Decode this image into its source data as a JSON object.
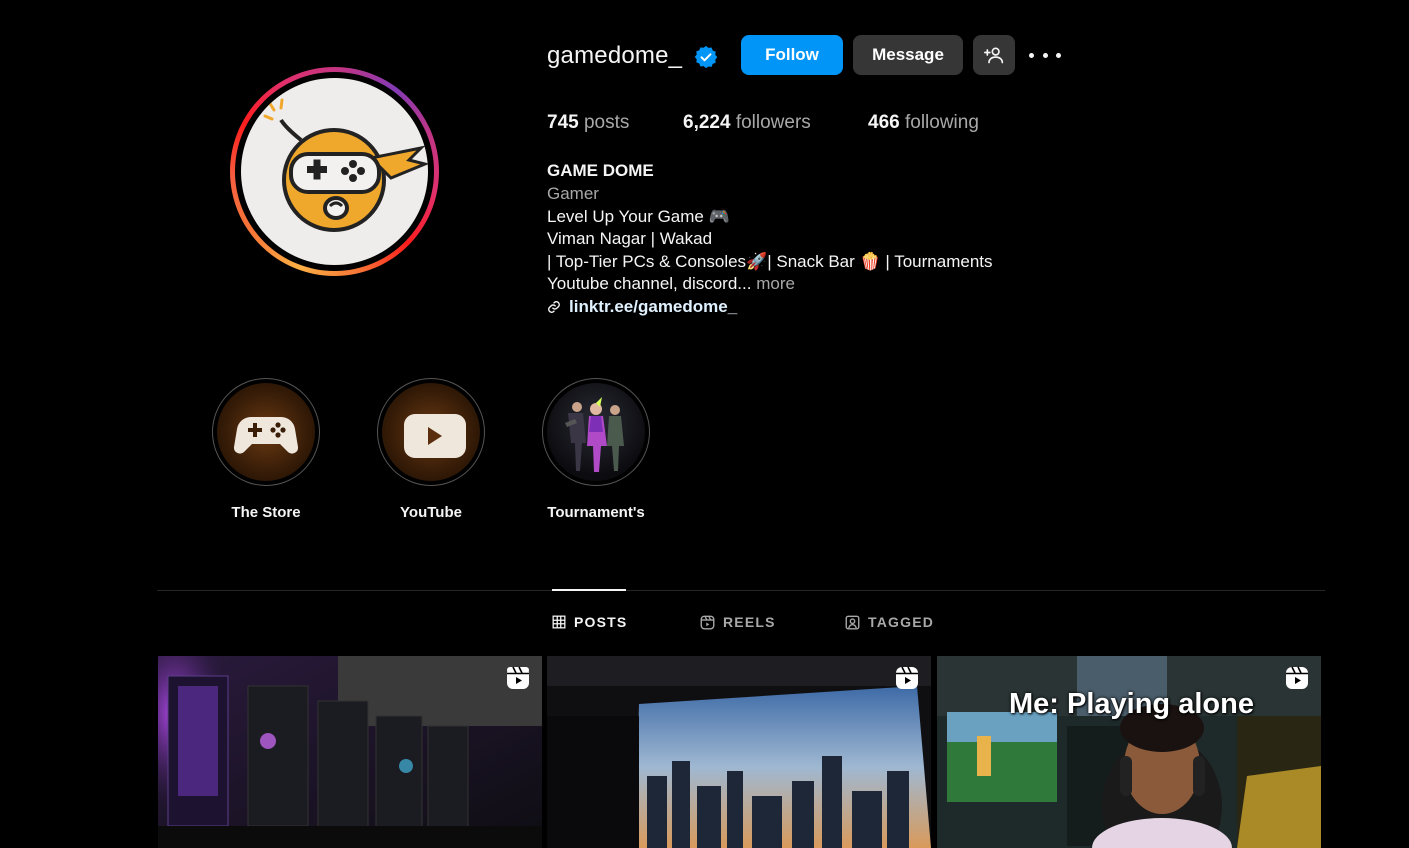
{
  "profile": {
    "username": "gamedome_",
    "verified": true,
    "follow_label": "Follow",
    "message_label": "Message",
    "stats": {
      "posts_count": "745",
      "posts_label": "posts",
      "followers_count": "6,224",
      "followers_label": "followers",
      "following_count": "466",
      "following_label": "following"
    },
    "bio": {
      "name": "GAME DOME",
      "category": "Gamer",
      "line1": "Level Up Your Game 🎮",
      "line2": "Viman Nagar | Wakad",
      "line3": "| Top-Tier PCs & Consoles🚀| Snack Bar 🍿 | Tournaments",
      "line4": "Youtube channel, discord...",
      "more_label": "more",
      "link": "linktr.ee/gamedome_"
    }
  },
  "highlights": [
    {
      "label": "The Store",
      "icon": "gamepad-icon"
    },
    {
      "label": "YouTube",
      "icon": "youtube-icon"
    },
    {
      "label": "Tournament's",
      "icon": "game-characters-image"
    }
  ],
  "tabs": [
    {
      "label": "POSTS",
      "icon": "grid-icon",
      "active": true
    },
    {
      "label": "REELS",
      "icon": "reels-icon",
      "active": false
    },
    {
      "label": "TAGGED",
      "icon": "tagged-icon",
      "active": false
    }
  ],
  "posts": [
    {
      "type": "reel",
      "overlay_text": ""
    },
    {
      "type": "reel",
      "overlay_text": ""
    },
    {
      "type": "reel",
      "overlay_text": "Me: Playing alone"
    }
  ],
  "colors": {
    "background": "#000000",
    "follow_button": "#0095f6",
    "secondary_button": "#363636",
    "verified_badge": "#0095f6",
    "muted_text": "#a8a8a8",
    "link_text": "#e0f1ff"
  }
}
